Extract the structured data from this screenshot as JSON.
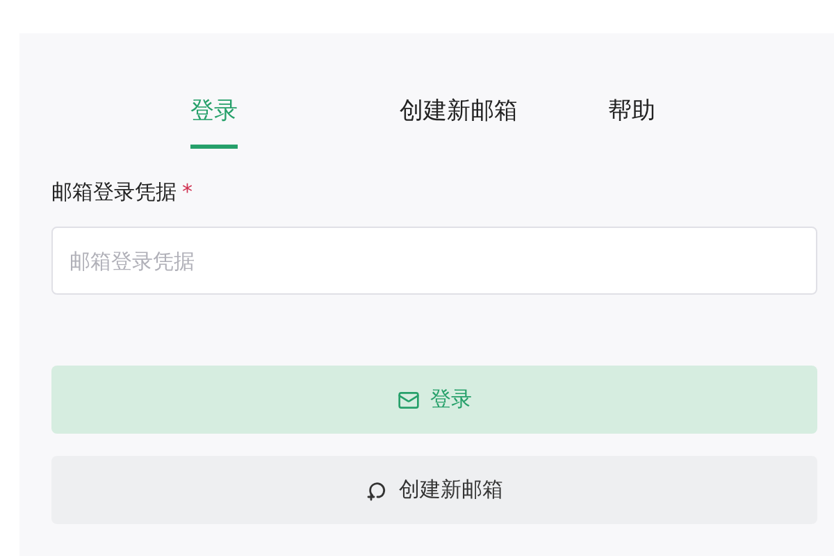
{
  "tabs": [
    {
      "label": "登录",
      "selected": true
    },
    {
      "label": "创建新邮箱",
      "selected": false
    },
    {
      "label": "帮助",
      "selected": false
    }
  ],
  "field": {
    "label": "邮箱登录凭据",
    "required_mark": "*",
    "placeholder": "邮箱登录凭据"
  },
  "buttons": [
    {
      "kind": "primary",
      "label": "登录"
    },
    {
      "kind": "secondary",
      "label": "创建新邮箱"
    }
  ]
}
